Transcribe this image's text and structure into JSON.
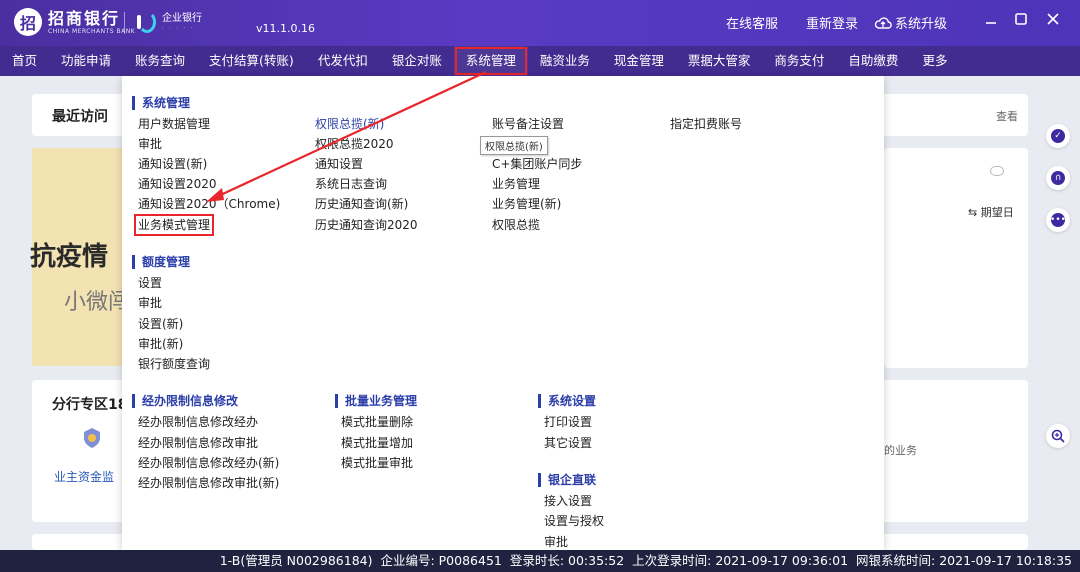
{
  "window": {
    "brand_cn": "招商银行",
    "brand_en": "CHINA MERCHANTS BANK",
    "brand_mark": "招",
    "enterprise_label": "企业银行",
    "version": "v11.1.0.16",
    "online_service": "在线客服",
    "relogin": "重新登录",
    "upgrade": "系统升级"
  },
  "nav": [
    "首页",
    "功能申请",
    "账务查询",
    "支付结算(转账)",
    "代发代扣",
    "银企对账",
    "系统管理",
    "融资业务",
    "现金管理",
    "票据大管家",
    "商务支付",
    "自助缴费",
    "更多"
  ],
  "nav_active_index": 6,
  "background": {
    "recent_title": "最近访问",
    "view_link": "查看",
    "banner_big": "抗疫情",
    "banner_small": "小微闯",
    "branch_title": "分行专区18",
    "left_link": "业主资金监",
    "due_date": "期望日",
    "right_text": "的业务"
  },
  "menu": {
    "system_title": "系统管理",
    "col1": [
      "用户数据管理",
      "审批",
      "通知设置(新)",
      "通知设置2020",
      "通知设置2020（Chrome)",
      "业务模式管理"
    ],
    "col2": [
      "权限总揽(新)",
      "权限总揽2020",
      "通知设置",
      "系统日志查询",
      "历史通知查询(新)",
      "历史通知查询2020"
    ],
    "col3": [
      "账号备注设置",
      "",
      "C+集团账户同步",
      "业务管理",
      "业务管理(新)",
      "权限总揽"
    ],
    "col4": [
      "指定扣费账号"
    ],
    "tooltip": "权限总揽(新)",
    "quota_title": "额度管理",
    "quota_items": [
      "设置",
      "审批",
      "设置(新)",
      "审批(新)",
      "银行额度查询"
    ],
    "limit_title": "经办限制信息修改",
    "limit_items": [
      "经办限制信息修改经办",
      "经办限制信息修改审批",
      "经办限制信息修改经办(新)",
      "经办限制信息修改审批(新)"
    ],
    "batch_title": "批量业务管理",
    "batch_items": [
      "模式批量删除",
      "模式批量增加",
      "模式批量审批"
    ],
    "settings_title": "系统设置",
    "settings_items": [
      "打印设置",
      "其它设置"
    ],
    "direct_title": "银企直联",
    "direct_items": [
      "接入设置",
      "设置与授权",
      "审批"
    ]
  },
  "status_bar": {
    "user": "1-B(管理员 N002986184)",
    "company_label": "企业编号:",
    "company_id": "P0086451",
    "duration_label": "登录时长:",
    "duration": "00:35:52",
    "last_login_label": "上次登录时间:",
    "last_login": "2021-09-17 09:36:01",
    "system_time_label": "网银系统时间:",
    "system_time": "2021-09-17 10:18:35"
  },
  "colors": {
    "title_bar": "#4b2fa0",
    "nav_bar": "#432c8f",
    "highlight": "#e8262b",
    "section_blue": "#2c3ea8",
    "status_bar": "#1f2340"
  }
}
